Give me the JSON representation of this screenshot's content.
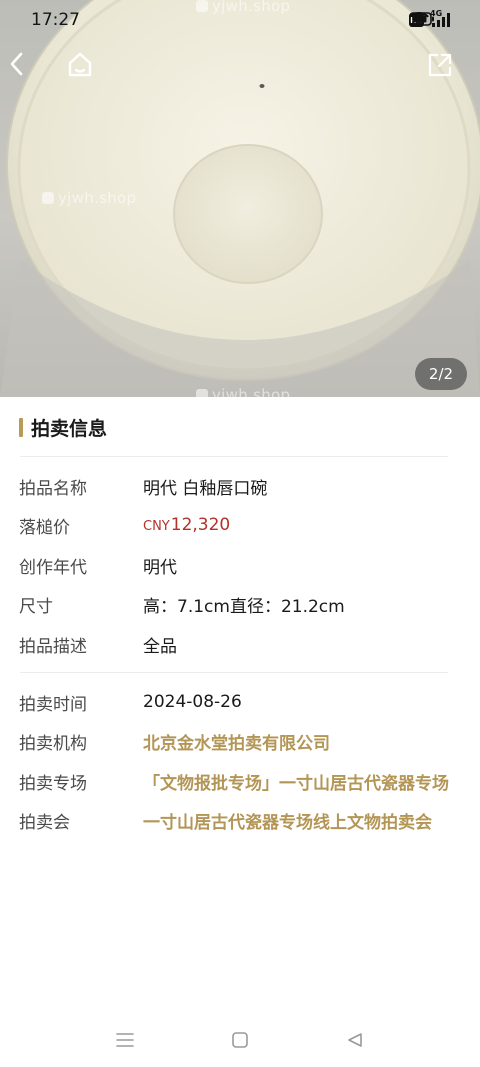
{
  "status_bar": {
    "time": "17:27",
    "icons": [
      "wifi-icon",
      "hd-icon",
      "4g-signal-icon",
      "battery-icon"
    ],
    "hd_label": "HD",
    "network_label": "4G"
  },
  "hero": {
    "watermark": "yjwh.shop",
    "page_counter": "2/2"
  },
  "nav": {
    "icons": [
      "back-icon",
      "home-icon",
      "share-icon"
    ]
  },
  "section": {
    "title": "拍卖信息",
    "accent_color": "#b89b56"
  },
  "details": [
    {
      "label": "拍品名称",
      "value": "明代 白釉唇口碗"
    },
    {
      "label": "落槌价",
      "currency": "CNY",
      "amount": "12,320"
    },
    {
      "label": "创作年代",
      "value": "明代"
    },
    {
      "label": "尺寸",
      "value": "高：7.1cm直径：21.2cm"
    },
    {
      "label": "拍品描述",
      "value": "全品"
    }
  ],
  "auction": [
    {
      "label": "拍卖时间",
      "value": "2024-08-26"
    },
    {
      "label": "拍卖机构",
      "value": "北京金水堂拍卖有限公司"
    },
    {
      "label": "拍卖专场",
      "value": "「文物报批专场」一寸山居古代瓷器专场"
    },
    {
      "label": "拍卖会",
      "value": "一寸山居古代瓷器专场线上文物拍卖会"
    }
  ],
  "colors": {
    "price": "#b3322a",
    "link_gold": "#b39656"
  },
  "system_nav": [
    "menu-icon",
    "home-square-icon",
    "back-triangle-icon"
  ]
}
